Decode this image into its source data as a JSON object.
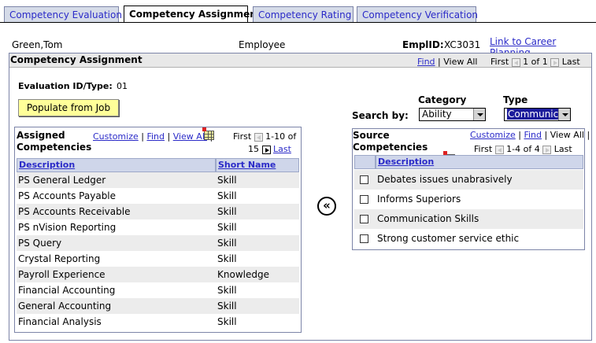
{
  "tabs": [
    {
      "label": "Competency Evaluation",
      "active": false
    },
    {
      "label": "Competency Assignment",
      "active": true
    },
    {
      "label": "Competency Rating",
      "active": false
    },
    {
      "label": "Competency Verification",
      "active": false
    }
  ],
  "header": {
    "employee_name": "Green,Tom",
    "employee_label": "Employee",
    "emplid_label": "EmplID:",
    "emplid_value": "XC3031",
    "career_link": "Link to Career Planning"
  },
  "section": {
    "title": "Competency Assignment",
    "find": "Find",
    "view_all": "View All",
    "first": "First",
    "range": "1 of 1",
    "last": "Last"
  },
  "evaluation": {
    "label": "Evaluation ID/Type:",
    "value": "01",
    "populate_button": "Populate from Job"
  },
  "search": {
    "label": "Search by:",
    "category_label": "Category",
    "category_value": "Ability",
    "type_label": "Type",
    "type_value": "Communic"
  },
  "assigned": {
    "title": "Assigned Competencies",
    "customize": "Customize",
    "find": "Find",
    "view_all": "View All",
    "first": "First",
    "range": "1-10 of",
    "total": "15",
    "last": "Last",
    "col_description": "Description",
    "col_short": "Short Name",
    "rows": [
      {
        "description": "PS General Ledger",
        "short": "Skill"
      },
      {
        "description": "PS Accounts Payable",
        "short": "Skill"
      },
      {
        "description": "PS Accounts Receivable",
        "short": "Skill"
      },
      {
        "description": "PS nVision Reporting",
        "short": "Skill"
      },
      {
        "description": "PS Query",
        "short": "Skill"
      },
      {
        "description": "Crystal Reporting",
        "short": "Skill"
      },
      {
        "description": "Payroll Experience",
        "short": "Knowledge"
      },
      {
        "description": "Financial Accounting",
        "short": "Skill"
      },
      {
        "description": "General Accounting",
        "short": "Skill"
      },
      {
        "description": "Financial Analysis",
        "short": "Skill"
      }
    ]
  },
  "move_button": "«",
  "source": {
    "title": "Source Competencies",
    "customize": "Customize",
    "find": "Find",
    "view_all": "View All",
    "first": "First",
    "range": "1-4 of 4",
    "last": "Last",
    "col_description": "Description",
    "rows": [
      {
        "description": "Debates issues unabrasively"
      },
      {
        "description": "Informs Superiors"
      },
      {
        "description": "Communication Skills"
      },
      {
        "description": "Strong customer service ethic"
      }
    ]
  }
}
